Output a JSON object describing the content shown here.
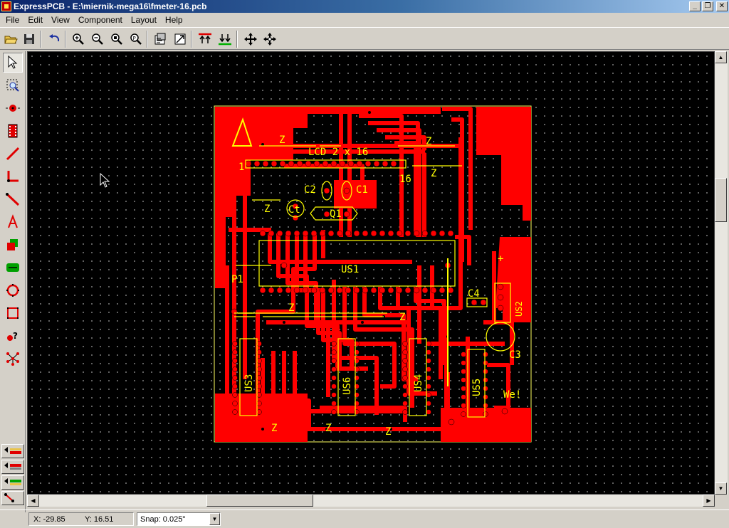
{
  "window": {
    "title": "ExpressPCB - E:\\miernik-mega16\\fmeter-16.pcb"
  },
  "menu": [
    "File",
    "Edit",
    "View",
    "Component",
    "Layout",
    "Help"
  ],
  "status": {
    "x": "X: -29.85",
    "y": "Y: 16.51",
    "snap": "Snap:  0.025\""
  },
  "silkscreen_labels": {
    "lcd": "LCD 2 x 16",
    "pin1": "1",
    "pin16": "16",
    "c2": "C2",
    "c1": "C1",
    "ct": "Ct",
    "q1": "Q1",
    "us1": "US1",
    "p1": "P1",
    "c4": "C4",
    "us2": "US2",
    "c3": "C3",
    "us3": "US3",
    "us6": "US6",
    "us4": "US4",
    "us5": "US5",
    "author": "We!",
    "plus": "+",
    "z": "Z"
  },
  "colors": {
    "copper_top": "#ff0000",
    "silkscreen": "#ffff00",
    "board_outline": "#ffff60",
    "background": "#000000"
  }
}
